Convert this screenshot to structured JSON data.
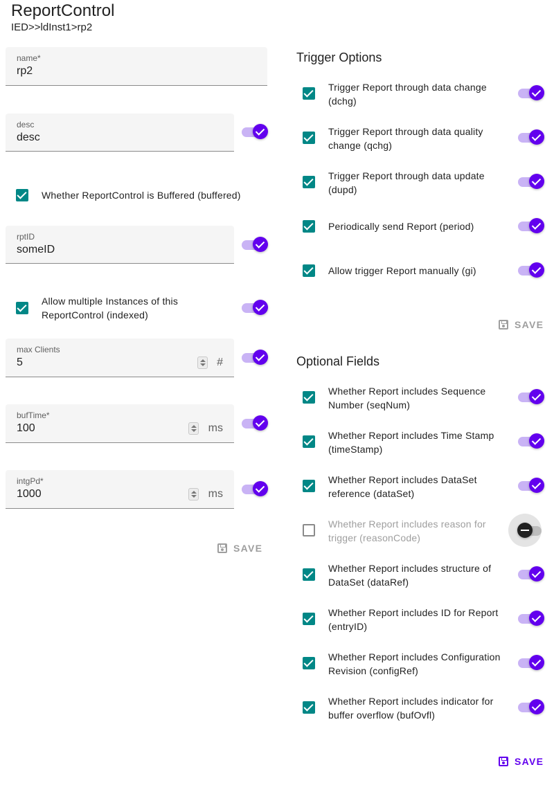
{
  "header": {
    "title": "ReportControl",
    "path": "IED>>ldInst1>rp2"
  },
  "left": {
    "name": {
      "label": "name*",
      "value": "rp2"
    },
    "desc": {
      "label": "desc",
      "value": "desc"
    },
    "buffered": {
      "label": "Whether ReportControl is Buffered (buffered)",
      "checked": true
    },
    "rptID": {
      "label": "rptID",
      "value": "someID"
    },
    "indexed": {
      "label_line1": "Allow multiple Instances of this",
      "label_line2": "ReportControl (indexed)",
      "checked": true
    },
    "maxClients": {
      "label": "max Clients",
      "value": "5",
      "suffix": "#"
    },
    "bufTime": {
      "label": "bufTime*",
      "value": "100",
      "suffix": "ms"
    },
    "intgPd": {
      "label": "intgPd*",
      "value": "1000",
      "suffix": "ms"
    },
    "save_label": "SAVE"
  },
  "trigger": {
    "title": "Trigger Options",
    "items": [
      {
        "line1": "Trigger Report through data change",
        "line2": "(dchg)",
        "checked": true
      },
      {
        "line1": "Trigger Report through data quality",
        "line2": "change (qchg)",
        "checked": true
      },
      {
        "line1": "Trigger Report through data update",
        "line2": "(dupd)",
        "checked": true
      },
      {
        "line1": "Periodically send Report (period)",
        "line2": "",
        "checked": true
      },
      {
        "line1": "Allow trigger Report manually (gi)",
        "line2": "",
        "checked": true
      }
    ],
    "save_label": "SAVE"
  },
  "optional": {
    "title": "Optional Fields",
    "items": [
      {
        "line1": "Whether Report includes Sequence",
        "line2": "Number (seqNum)",
        "checked": true
      },
      {
        "line1": "Whether Report includes Time Stamp",
        "line2": "(timeStamp)",
        "checked": true
      },
      {
        "line1": "Whether Report includes DataSet",
        "line2": "reference (dataSet)",
        "checked": true
      },
      {
        "line1": "Whether Report includes reason for",
        "line2": "trigger (reasonCode)",
        "checked": false
      },
      {
        "line1": "Whether Report includes structure of",
        "line2": "DataSet (dataRef)",
        "checked": true
      },
      {
        "line1": "Whether Report includes ID for Report",
        "line2": "(entryID)",
        "checked": true
      },
      {
        "line1": "Whether Report includes Configuration",
        "line2": "Revision (configRef)",
        "checked": true
      },
      {
        "line1": "Whether Report includes indicator for",
        "line2": "buffer overflow (bufOvfl)",
        "checked": true
      }
    ],
    "save_label": "SAVE"
  },
  "icons": {
    "save": "floppy-disk-icon",
    "check": "check-icon",
    "minus": "minus-icon"
  },
  "colors": {
    "primary": "#6200ee",
    "secondary": "#018786",
    "track_on": "#c9b3f5"
  }
}
